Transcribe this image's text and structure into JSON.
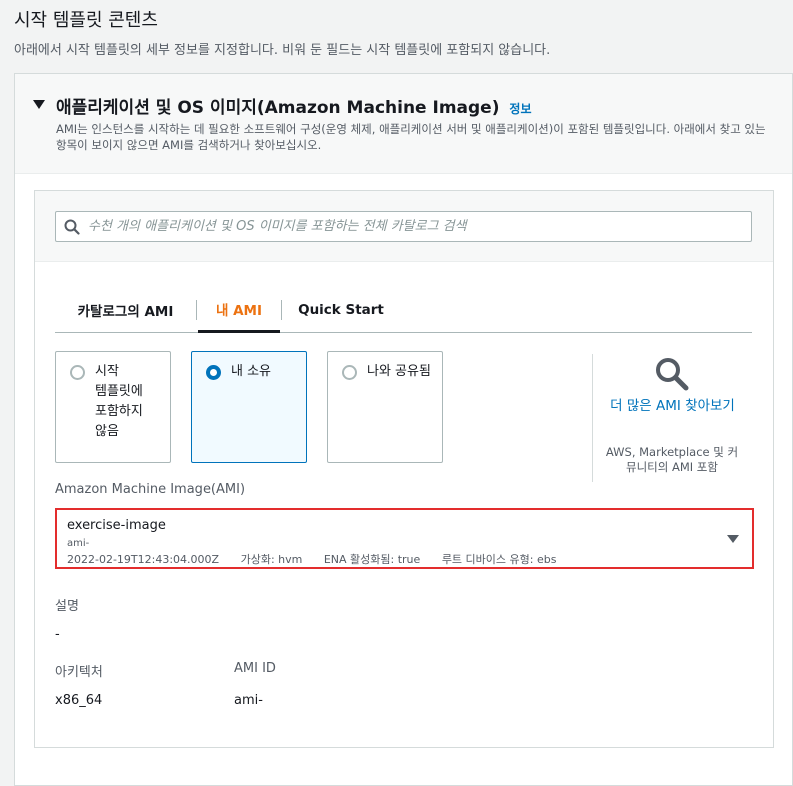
{
  "page": {
    "title": "시작 템플릿 콘텐츠",
    "description": "아래에서 시작 템플릿의 세부 정보를 지정합니다. 비워 둔 필드는 시작 템플릿에 포함되지 않습니다."
  },
  "section": {
    "title": "애플리케이션 및 OS 이미지(Amazon Machine Image)",
    "info_link": "정보",
    "description": "AMI는 인스턴스를 시작하는 데 필요한 소프트웨어 구성(운영 체제, 애플리케이션 서버 및 애플리케이션)이 포함된 템플릿입니다. 아래에서 찾고 있는 항목이 보이지 않으면 AMI를 검색하거나 찾아보십시오."
  },
  "search": {
    "placeholder": "수천 개의 애플리케이션 및 OS 이미지를 포함하는 전체 카탈로그 검색",
    "value": ""
  },
  "tabs": [
    {
      "label": "카탈로그의 AMI",
      "active": false
    },
    {
      "label": "내 AMI",
      "active": true
    },
    {
      "label": "Quick Start",
      "active": false
    }
  ],
  "ownership_options": [
    {
      "label": "시작 템플릿에 포함하지 않음",
      "selected": false
    },
    {
      "label": "내 소유",
      "selected": true
    },
    {
      "label": "나와 공유됨",
      "selected": false
    }
  ],
  "browse": {
    "link": "더 많은 AMI 찾아보기",
    "description": "AWS, Marketplace 및 커뮤니티의 AMI 포함"
  },
  "ami_select": {
    "label": "Amazon Machine Image(AMI)",
    "name": "exercise-image",
    "id": "ami-",
    "created": "2022-02-19T12:43:04.000Z",
    "virtualization": "가상화: hvm",
    "ena": "ENA 활성화됨: true",
    "root_device": "루트 디바이스 유형: ebs"
  },
  "details": {
    "description_label": "설명",
    "description_value": "-",
    "architecture_label": "아키텍처",
    "architecture_value": "x86_64",
    "ami_id_label": "AMI ID",
    "ami_id_value": "ami-"
  },
  "colors": {
    "link": "#0073bb",
    "active_tab": "#ec7211",
    "highlight_border": "#e32d2d",
    "selected_tile_bg": "#f1faff"
  }
}
